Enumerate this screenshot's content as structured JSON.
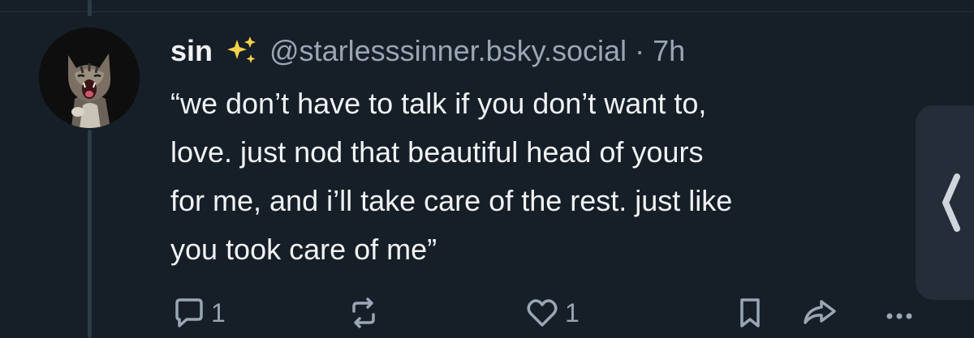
{
  "post": {
    "author": {
      "display_name": "sin",
      "emoji": "sparkles-icon",
      "handle": "@starlesssinner.bsky.social",
      "separator": "·",
      "time_ago": "7h"
    },
    "text_lines": [
      "“we don’t have to talk if you don’t want to,",
      "love. just nod that beautiful head of yours",
      "for me, and i’ll take care of the rest. just like",
      "you took care of me”"
    ],
    "actions": {
      "reply_count": "1",
      "like_count": "1"
    }
  },
  "colors": {
    "background": "#161e27",
    "text": "#f1f3f5",
    "muted": "#9aa6b4",
    "thread_line": "#2e3a48",
    "side_handle": "#242d38"
  },
  "icons": [
    "avatar-cat",
    "sparkles-icon",
    "reply-icon",
    "repost-icon",
    "like-icon",
    "bookmark-icon",
    "share-icon",
    "more-icon",
    "chevron-left-icon"
  ]
}
